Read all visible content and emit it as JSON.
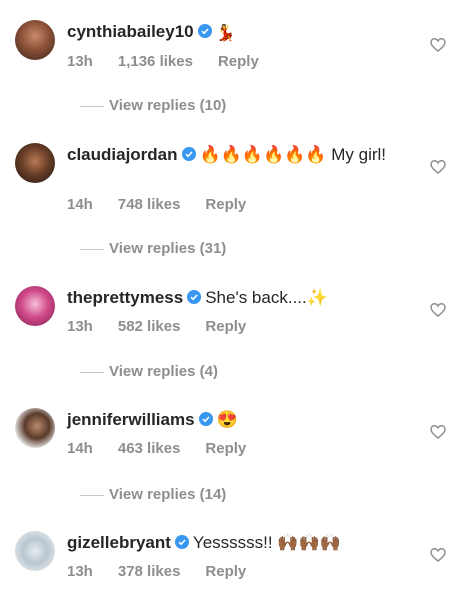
{
  "comments": [
    {
      "username": "cynthiabailey10",
      "text": "💃",
      "time": "13h",
      "likes": "1,136 likes",
      "reply": "Reply",
      "view_replies": "View replies (10)"
    },
    {
      "username": "claudiajordan",
      "text": "🔥🔥🔥🔥🔥🔥 My girl!",
      "time": "14h",
      "likes": "748 likes",
      "reply": "Reply",
      "view_replies": "View replies (31)"
    },
    {
      "username": "theprettymess",
      "text": "She's back....✨",
      "time": "13h",
      "likes": "582 likes",
      "reply": "Reply",
      "view_replies": "View replies (4)"
    },
    {
      "username": "jenniferwilliams",
      "text": "😍",
      "time": "14h",
      "likes": "463 likes",
      "reply": "Reply",
      "view_replies": "View replies (14)"
    },
    {
      "username": "gizellebryant",
      "text": "Yessssss!! 🙌🏾🙌🏾🙌🏾",
      "time": "13h",
      "likes": "378 likes",
      "reply": "Reply"
    }
  ],
  "icons": {
    "verified": "verified-badge-icon",
    "heart": "heart-outline-icon"
  },
  "colors": {
    "verified": "#3897f0",
    "meta": "#8e8e8e",
    "text": "#262626"
  }
}
